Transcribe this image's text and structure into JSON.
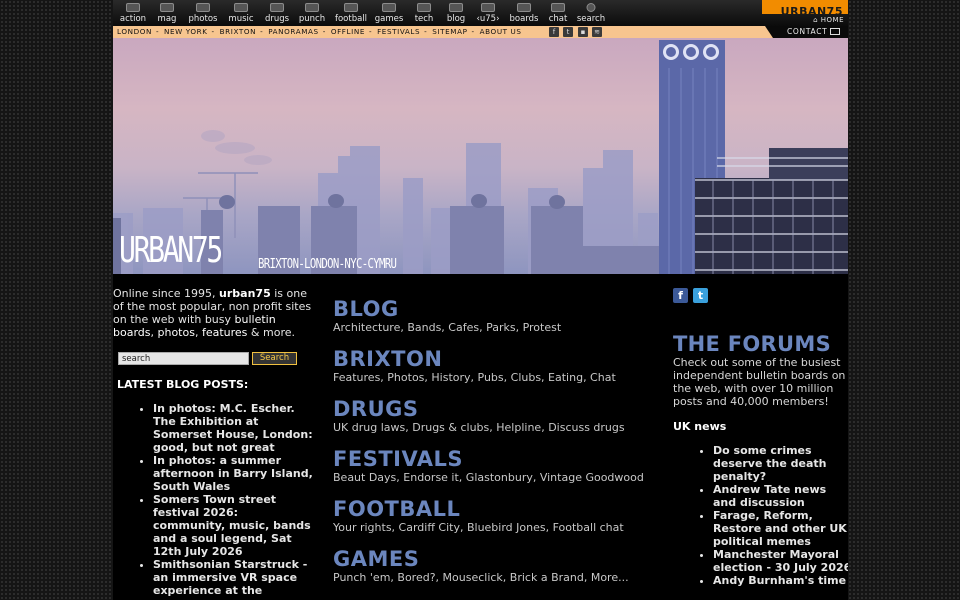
{
  "nav": {
    "items": [
      {
        "label": "action",
        "icon": "action-icon"
      },
      {
        "label": "mag",
        "icon": "mag-icon"
      },
      {
        "label": "photos",
        "icon": "photos-icon"
      },
      {
        "label": "music",
        "icon": "music-icon"
      },
      {
        "label": "drugs",
        "icon": "drugs-icon"
      },
      {
        "label": "punch",
        "icon": "punch-icon"
      },
      {
        "label": "football",
        "icon": "football-icon"
      },
      {
        "label": "games",
        "icon": "games-icon"
      },
      {
        "label": "tech",
        "icon": "tech-icon"
      },
      {
        "label": "blog",
        "icon": "blog-icon"
      },
      {
        "label": "‹u75›",
        "icon": "u75-icon"
      },
      {
        "label": "boards",
        "icon": "boards-icon"
      },
      {
        "label": "chat",
        "icon": "chat-icon"
      },
      {
        "label": "search",
        "icon": "search-icon"
      }
    ],
    "logo": "URBAN75",
    "home": "⌂ HOME",
    "accent": "#f28c00"
  },
  "subnav": {
    "links": [
      "LONDON",
      "NEW YORK",
      "BRIXTON",
      "PANORAMAS",
      "OFFLINE",
      "FESTIVALS",
      "SITEMAP",
      "ABOUT US"
    ],
    "contact": "CONTACT",
    "bar_color": "#f7c58f"
  },
  "banner": {
    "title": "URBAN75",
    "subtitle": "BRIXTON-LONDON-NYC-CYMRU"
  },
  "intro": {
    "pre": "Online since 1995, ",
    "site": "urban75",
    "mid1": " is one of the most popular, non profit sites on the web with busy ",
    "boards": "bulletin boards",
    "sep": ", ",
    "photos": "photos",
    "sep2": ", ",
    "features": "features",
    "post": " & more."
  },
  "search": {
    "placeholder": "search",
    "value": "search",
    "button": "Search"
  },
  "latest": {
    "prefix": "LATEST ",
    "label": "BLOG POSTS:",
    "posts": [
      "In photos: M.C. Escher. The Exhibition at Somerset House, London: good, but not great",
      "In photos: a summer afternoon in Barry Island, South Wales",
      "Somers Town street festival 2026: community, music, bands and a soul legend, Sat 12th July 2026",
      "Smithsonian Starstruck - an immersive VR space experience at the"
    ]
  },
  "categories": [
    {
      "title": "BLOG",
      "sub": "Architecture, Bands, Cafes, Parks, Protest"
    },
    {
      "title": "BRIXTON",
      "sub": "Features, Photos, History, Pubs, Clubs, Eating, Chat"
    },
    {
      "title": "DRUGS",
      "sub": "UK drug laws, Drugs & clubs, Helpline, Discuss drugs"
    },
    {
      "title": "FESTIVALS",
      "sub": "Beaut Days, Endorse it, Glastonbury, Vintage Goodwood"
    },
    {
      "title": "FOOTBALL",
      "sub": "Your rights, Cardiff City, Bluebird Jones, Football chat"
    },
    {
      "title": "GAMES",
      "sub": "Punch 'em, Bored?, Mouseclick, Brick a Brand, More..."
    }
  ],
  "forums": {
    "title": "THE FORUMS",
    "desc": "Check out some of the busiest independent bulletin boards on the web, with over 10 million posts and 40,000 members!",
    "news_label": "UK news",
    "news": [
      "Do some crimes deserve the death penalty?",
      "Andrew Tate news and discussion",
      "Farage, Reform, Restore and other UK political memes",
      "Manchester Mayoral election - 30 July 2026",
      "Andy Burnham's time"
    ]
  },
  "social": {
    "facebook": "f",
    "twitter": "t"
  },
  "colors": {
    "heading": "#6b86be",
    "page_bg": "#151515"
  }
}
